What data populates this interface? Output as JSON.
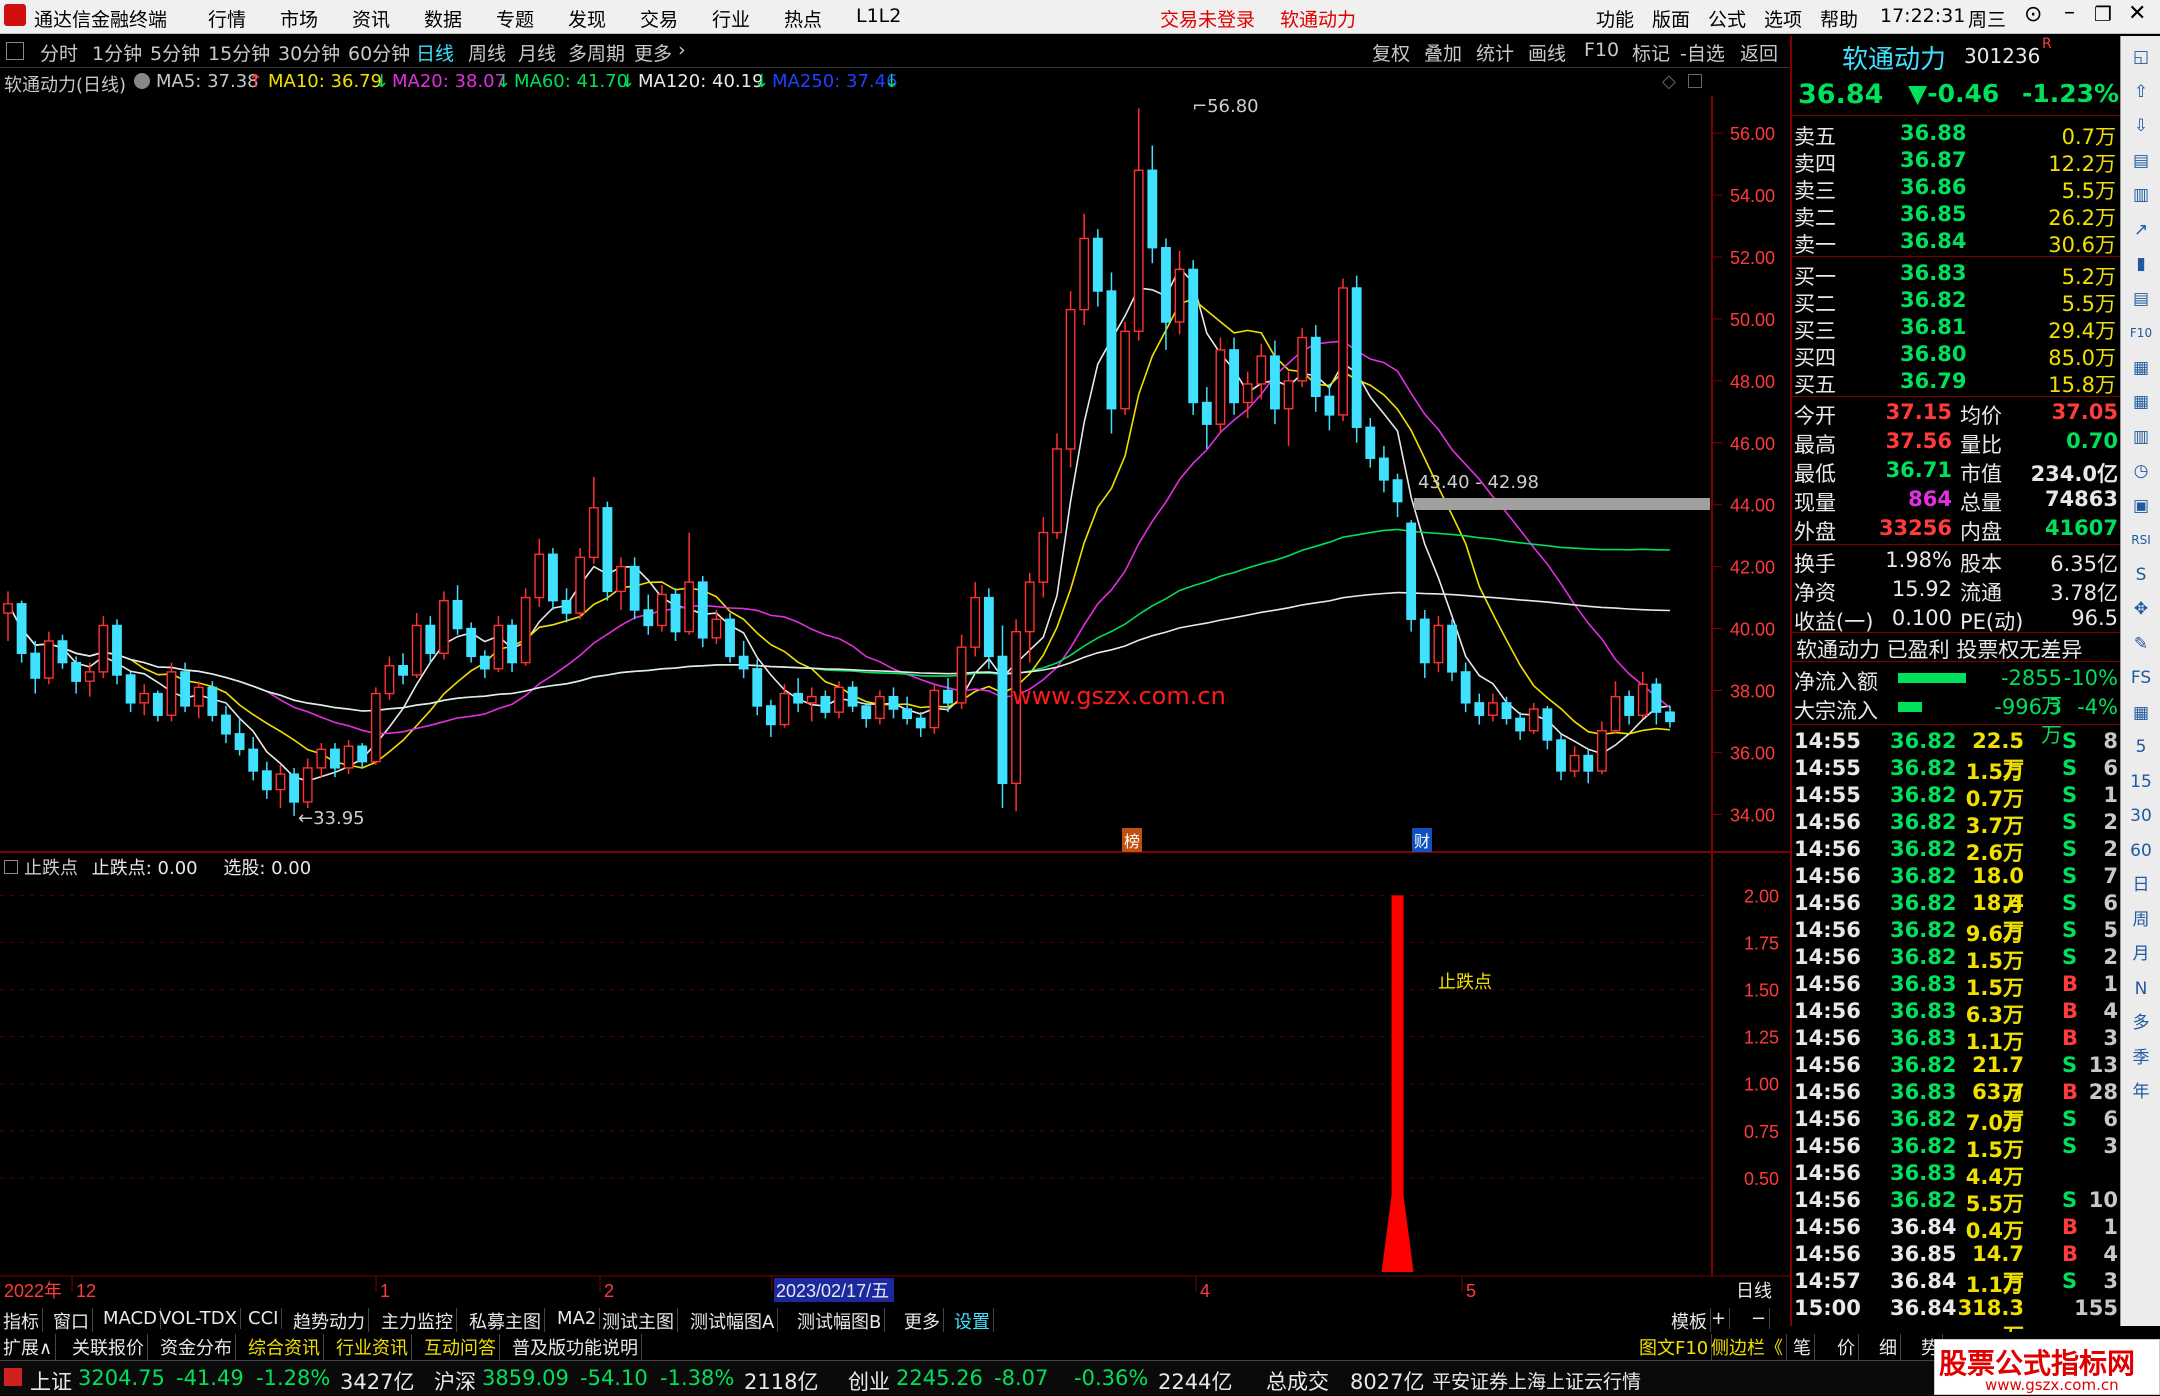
{
  "titlebar": {
    "app_name": "通达信金融终端",
    "menus": [
      "行情",
      "市场",
      "资讯",
      "数据",
      "专题",
      "发现",
      "交易",
      "行业",
      "热点",
      "L1L2"
    ],
    "login_status": "交易未登录",
    "stock_name": "软通动力",
    "right_menus": [
      "功能",
      "版面",
      "公式",
      "选项",
      "帮助"
    ],
    "time": "17:22:31",
    "weekday": "周三"
  },
  "timeframes": [
    "分时",
    "1分钟",
    "5分钟",
    "15分钟",
    "30分钟",
    "60分钟",
    "日线",
    "周线",
    "月线",
    "多周期",
    "更多"
  ],
  "active_timeframe": "日线",
  "toolbar_buttons": [
    "复权",
    "叠加",
    "统计",
    "画线",
    "F10",
    "标记",
    "-自选",
    "返回"
  ],
  "ma_bar": {
    "title": "软通动力(日线)",
    "items": [
      {
        "label": "MA5: 37.38",
        "color": "#e8e8e8",
        "arrow": "↑"
      },
      {
        "label": "MA10: 36.79",
        "color": "#f0e000",
        "arrow": "↓"
      },
      {
        "label": "MA20: 38.07",
        "color": "#e030e0",
        "arrow": "↓"
      },
      {
        "label": "MA60: 41.70",
        "color": "#00e05a",
        "arrow": "↓"
      },
      {
        "label": "MA120: 40.19",
        "color": "#e8e8e8",
        "arrow": "↓"
      },
      {
        "label": "MA250: 37.46",
        "color": "#2040ff",
        "arrow": "↓"
      }
    ]
  },
  "chart_data": [
    {
      "type": "candlestick",
      "title": "软通动力(日线)",
      "y_ticks": [
        "56.00",
        "54.00",
        "52.00",
        "50.00",
        "48.00",
        "46.00",
        "44.00",
        "42.00",
        "40.00",
        "38.00",
        "36.00",
        "34.00"
      ],
      "ylim": [
        33.3,
        57.2
      ],
      "annotations": {
        "high": "56.80",
        "low": "33.95",
        "gap": "43.40 - 42.98",
        "markers": [
          "榜",
          "财"
        ],
        "watermark": "www.gszx.com.cn"
      },
      "candles": [
        [
          40.5,
          41.2,
          39.6,
          40.8
        ],
        [
          40.8,
          40.9,
          38.9,
          39.2
        ],
        [
          39.2,
          39.6,
          37.9,
          38.4
        ],
        [
          38.4,
          39.9,
          38.2,
          39.6
        ],
        [
          39.6,
          39.8,
          38.7,
          38.9
        ],
        [
          38.9,
          39.1,
          37.9,
          38.3
        ],
        [
          38.3,
          38.9,
          37.8,
          38.6
        ],
        [
          38.6,
          40.4,
          38.4,
          40.1
        ],
        [
          40.1,
          40.3,
          38.2,
          38.5
        ],
        [
          38.5,
          38.6,
          37.3,
          37.6
        ],
        [
          37.6,
          38.2,
          37.2,
          37.9
        ],
        [
          37.9,
          38.0,
          37.0,
          37.2
        ],
        [
          37.2,
          38.9,
          37.0,
          38.6
        ],
        [
          38.6,
          38.9,
          37.3,
          37.5
        ],
        [
          37.5,
          38.3,
          37.1,
          38.1
        ],
        [
          38.1,
          38.3,
          37.0,
          37.2
        ],
        [
          37.2,
          37.5,
          36.3,
          36.6
        ],
        [
          36.6,
          37.1,
          35.9,
          36.1
        ],
        [
          36.1,
          36.5,
          35.1,
          35.4
        ],
        [
          35.4,
          35.7,
          34.5,
          34.8
        ],
        [
          34.8,
          35.6,
          34.2,
          35.3
        ],
        [
          35.3,
          35.5,
          33.95,
          34.4
        ],
        [
          34.4,
          35.8,
          34.2,
          35.5
        ],
        [
          35.5,
          36.3,
          35.2,
          36.1
        ],
        [
          36.1,
          36.3,
          35.2,
          35.5
        ],
        [
          35.5,
          36.4,
          35.3,
          36.2
        ],
        [
          36.2,
          36.3,
          35.5,
          35.7
        ],
        [
          35.7,
          38.1,
          35.6,
          37.9
        ],
        [
          37.9,
          39.1,
          37.7,
          38.8
        ],
        [
          38.8,
          39.2,
          38.2,
          38.5
        ],
        [
          38.5,
          40.5,
          38.4,
          40.1
        ],
        [
          40.1,
          40.4,
          38.9,
          39.2
        ],
        [
          39.2,
          41.2,
          39.0,
          40.9
        ],
        [
          40.9,
          41.4,
          39.8,
          40.0
        ],
        [
          40.0,
          40.2,
          38.9,
          39.1
        ],
        [
          39.1,
          39.3,
          38.4,
          38.7
        ],
        [
          38.7,
          40.4,
          38.6,
          40.1
        ],
        [
          40.1,
          40.3,
          38.6,
          38.9
        ],
        [
          38.9,
          41.3,
          38.8,
          41.0
        ],
        [
          41.0,
          42.9,
          40.7,
          42.4
        ],
        [
          42.4,
          42.6,
          40.6,
          40.9
        ],
        [
          40.9,
          41.3,
          40.2,
          40.5
        ],
        [
          40.5,
          42.6,
          40.3,
          42.3
        ],
        [
          42.3,
          44.9,
          42.1,
          43.9
        ],
        [
          43.9,
          44.1,
          40.9,
          41.2
        ],
        [
          41.2,
          42.3,
          40.6,
          42.0
        ],
        [
          42.0,
          42.3,
          40.3,
          40.6
        ],
        [
          40.6,
          41.1,
          39.8,
          40.1
        ],
        [
          40.1,
          41.4,
          39.9,
          41.1
        ],
        [
          41.1,
          41.3,
          39.6,
          39.9
        ],
        [
          39.9,
          43.1,
          39.8,
          41.5
        ],
        [
          41.5,
          41.7,
          39.4,
          39.7
        ],
        [
          39.7,
          40.6,
          39.5,
          40.3
        ],
        [
          40.3,
          40.5,
          38.9,
          39.1
        ],
        [
          39.1,
          39.6,
          38.4,
          38.7
        ],
        [
          38.7,
          39.0,
          37.2,
          37.5
        ],
        [
          37.5,
          37.7,
          36.5,
          36.9
        ],
        [
          36.9,
          38.2,
          36.8,
          37.9
        ],
        [
          37.9,
          38.4,
          37.3,
          37.6
        ],
        [
          37.6,
          38.1,
          37.0,
          37.8
        ],
        [
          37.8,
          38.0,
          37.1,
          37.3
        ],
        [
          37.3,
          38.3,
          37.1,
          38.1
        ],
        [
          38.1,
          38.3,
          37.3,
          37.5
        ],
        [
          37.5,
          37.6,
          36.8,
          37.1
        ],
        [
          37.1,
          38.0,
          36.9,
          37.8
        ],
        [
          37.8,
          38.1,
          37.1,
          37.4
        ],
        [
          37.4,
          37.8,
          36.9,
          37.1
        ],
        [
          37.1,
          37.3,
          36.5,
          36.8
        ],
        [
          36.8,
          38.2,
          36.6,
          38.0
        ],
        [
          38.0,
          38.4,
          37.3,
          37.6
        ],
        [
          37.6,
          39.8,
          37.4,
          39.4
        ],
        [
          39.4,
          41.5,
          39.1,
          41.0
        ],
        [
          41.0,
          41.3,
          38.7,
          39.1
        ],
        [
          39.1,
          40.1,
          34.2,
          35.0
        ],
        [
          35.0,
          40.3,
          34.1,
          39.9
        ],
        [
          39.9,
          41.8,
          38.9,
          41.5
        ],
        [
          41.5,
          43.6,
          41.0,
          43.1
        ],
        [
          43.1,
          46.3,
          42.9,
          45.8
        ],
        [
          45.8,
          50.9,
          45.2,
          50.3
        ],
        [
          50.3,
          53.4,
          49.8,
          52.6
        ],
        [
          52.6,
          52.9,
          50.4,
          50.9
        ],
        [
          50.9,
          51.5,
          46.3,
          47.1
        ],
        [
          47.1,
          49.9,
          46.9,
          49.6
        ],
        [
          49.6,
          56.8,
          49.3,
          54.8
        ],
        [
          54.8,
          55.6,
          51.8,
          52.3
        ],
        [
          52.3,
          52.6,
          49.0,
          49.9
        ],
        [
          49.9,
          52.2,
          49.5,
          51.6
        ],
        [
          51.6,
          51.9,
          46.9,
          47.3
        ],
        [
          47.3,
          47.8,
          45.8,
          46.6
        ],
        [
          46.6,
          49.4,
          46.3,
          49.0
        ],
        [
          49.0,
          49.4,
          46.9,
          47.3
        ],
        [
          47.3,
          48.3,
          46.8,
          47.9
        ],
        [
          47.9,
          49.2,
          47.4,
          48.8
        ],
        [
          48.8,
          49.3,
          46.6,
          47.1
        ],
        [
          47.1,
          48.3,
          45.9,
          48.0
        ],
        [
          48.0,
          49.7,
          47.8,
          49.4
        ],
        [
          49.4,
          49.8,
          47.0,
          47.5
        ],
        [
          47.5,
          47.9,
          46.4,
          46.9
        ],
        [
          46.9,
          51.3,
          46.7,
          51.0
        ],
        [
          51.0,
          51.4,
          46.0,
          46.5
        ],
        [
          46.5,
          46.8,
          45.2,
          45.5
        ],
        [
          45.5,
          45.9,
          44.4,
          44.8
        ],
        [
          44.8,
          45.0,
          43.6,
          44.1
        ],
        [
          43.4,
          43.5,
          39.9,
          40.3
        ],
        [
          40.3,
          40.6,
          38.4,
          38.9
        ],
        [
          38.9,
          40.4,
          38.6,
          40.1
        ],
        [
          40.1,
          40.3,
          38.3,
          38.6
        ],
        [
          38.6,
          38.9,
          37.3,
          37.6
        ],
        [
          37.6,
          37.9,
          36.9,
          37.2
        ],
        [
          37.2,
          37.9,
          37.0,
          37.6
        ],
        [
          37.6,
          37.8,
          36.9,
          37.1
        ],
        [
          37.1,
          37.3,
          36.4,
          36.7
        ],
        [
          36.7,
          37.6,
          36.6,
          37.4
        ],
        [
          37.4,
          37.5,
          36.1,
          36.4
        ],
        [
          36.4,
          36.6,
          35.1,
          35.4
        ],
        [
          35.4,
          36.2,
          35.2,
          35.9
        ],
        [
          35.9,
          36.1,
          35.0,
          35.4
        ],
        [
          35.4,
          37.0,
          35.3,
          36.7
        ],
        [
          36.7,
          38.3,
          36.6,
          37.8
        ],
        [
          37.8,
          38.0,
          36.9,
          37.2
        ],
        [
          37.2,
          38.6,
          37.1,
          38.2
        ],
        [
          38.2,
          38.4,
          36.9,
          37.3
        ],
        [
          37.3,
          37.5,
          36.8,
          37.0
        ]
      ]
    },
    {
      "type": "bar",
      "title": "止跌点",
      "values_text": "止跌点: 0.00",
      "select_text": "选股: 0.00",
      "y_ticks": [
        "2.00",
        "1.75",
        "1.50",
        "1.25",
        "1.00",
        "0.75",
        "0.50"
      ],
      "ylim": [
        0,
        2.05
      ],
      "spike_label": "止跌点",
      "spike_value": 2.0
    }
  ],
  "x_axis": [
    "2022年",
    "12",
    "1",
    "2",
    "2023/02/17/五",
    "4",
    "5",
    "日线"
  ],
  "quote": {
    "name": "软通动力",
    "code": "301236",
    "badge": "R",
    "price": "36.84",
    "change": "▼-0.46",
    "pct": "-1.23%",
    "asks": [
      {
        "label": "卖五",
        "price": "36.88",
        "vol": "0.7万"
      },
      {
        "label": "卖四",
        "price": "36.87",
        "vol": "12.2万"
      },
      {
        "label": "卖三",
        "price": "36.86",
        "vol": "5.5万"
      },
      {
        "label": "卖二",
        "price": "36.85",
        "vol": "26.2万"
      },
      {
        "label": "卖一",
        "price": "36.84",
        "vol": "30.6万"
      }
    ],
    "bids": [
      {
        "label": "买一",
        "price": "36.83",
        "vol": "5.2万"
      },
      {
        "label": "买二",
        "price": "36.82",
        "vol": "5.5万"
      },
      {
        "label": "买三",
        "price": "36.81",
        "vol": "29.4万"
      },
      {
        "label": "买四",
        "price": "36.80",
        "vol": "85.0万"
      },
      {
        "label": "买五",
        "price": "36.79",
        "vol": "15.8万"
      }
    ],
    "stats1": [
      {
        "l1": "今开",
        "v1": "37.15",
        "c1": "#ff3b3b",
        "l2": "均价",
        "v2": "37.05",
        "c2": "#ff3b3b"
      },
      {
        "l1": "最高",
        "v1": "37.56",
        "c1": "#ff3b3b",
        "l2": "量比",
        "v2": "0.70",
        "c2": "#00e05a"
      },
      {
        "l1": "最低",
        "v1": "36.71",
        "c1": "#00e05a",
        "l2": "市值",
        "v2": "234.0亿",
        "c2": "#e8e8e8"
      },
      {
        "l1": "现量",
        "v1": "864",
        "c1": "#e030e0",
        "l2": "总量",
        "v2": "74863",
        "c2": "#e8e8e8"
      },
      {
        "l1": "外盘",
        "v1": "33256",
        "c1": "#ff3b3b",
        "l2": "内盘",
        "v2": "41607",
        "c2": "#00e05a"
      }
    ],
    "stats2": [
      {
        "l1": "换手",
        "v1": "1.98%",
        "l2": "股本",
        "v2": "6.35亿"
      },
      {
        "l1": "净资",
        "v1": "15.92",
        "l2": "流通",
        "v2": "3.78亿"
      },
      {
        "l1": "收益(一)",
        "v1": "0.100",
        "l2": "PE(动)",
        "v2": "96.5"
      }
    ],
    "tags": "软通动力 已盈利 投票权无差异",
    "flows": [
      {
        "label": "净流入额",
        "value": "-2855万",
        "pct": "-10%",
        "bar": 0.62
      },
      {
        "label": "大宗流入",
        "value": "-996.3万",
        "pct": "-4%",
        "bar": 0.22
      }
    ]
  },
  "ticks": [
    [
      "14:55",
      "36.82",
      "22.5万",
      "S",
      "8"
    ],
    [
      "14:55",
      "36.82",
      "1.5万",
      "S",
      "6"
    ],
    [
      "14:55",
      "36.82",
      "0.7万",
      "S",
      "1"
    ],
    [
      "14:56",
      "36.82",
      "3.7万",
      "S",
      "2"
    ],
    [
      "14:56",
      "36.82",
      "2.6万",
      "S",
      "2"
    ],
    [
      "14:56",
      "36.82",
      "18.0万",
      "S",
      "7"
    ],
    [
      "14:56",
      "36.82",
      "18.4万",
      "S",
      "6"
    ],
    [
      "14:56",
      "36.82",
      "9.6万",
      "S",
      "5"
    ],
    [
      "14:56",
      "36.82",
      "1.5万",
      "S",
      "2"
    ],
    [
      "14:56",
      "36.83",
      "1.5万",
      "B",
      "1"
    ],
    [
      "14:56",
      "36.83",
      "6.3万",
      "B",
      "4"
    ],
    [
      "14:56",
      "36.83",
      "1.1万",
      "B",
      "3"
    ],
    [
      "14:56",
      "36.82",
      "21.7万",
      "S",
      "13"
    ],
    [
      "14:56",
      "36.83",
      "63.7万",
      "B",
      "28"
    ],
    [
      "14:56",
      "36.82",
      "7.0万",
      "S",
      "6"
    ],
    [
      "14:56",
      "36.82",
      "1.5万",
      "S",
      "3"
    ],
    [
      "14:56",
      "36.83",
      "4.4万",
      "",
      ""
    ],
    [
      "14:56",
      "36.82",
      "5.5万",
      "S",
      "10"
    ],
    [
      "14:56",
      "36.84",
      "0.4万",
      "B",
      "1"
    ],
    [
      "14:56",
      "36.85",
      "14.7万",
      "B",
      "4"
    ],
    [
      "14:57",
      "36.84",
      "1.1万",
      "S",
      "3"
    ],
    [
      "15:00",
      "36.84",
      "318.3万",
      "",
      "155"
    ]
  ],
  "bottom_tabs": [
    "指标",
    "窗口",
    "MACD",
    "VOL-TDX",
    "CCI",
    "趋势动力",
    "主力监控",
    "私募主图",
    "MA2",
    "测试主图",
    "测试幅图A",
    "测试幅图B",
    "更多",
    "设置"
  ],
  "bottom_right_tabs": [
    "模板",
    "+",
    "−"
  ],
  "bottom_tabs2": [
    "扩展∧",
    "关联报价",
    "资金分布",
    "综合资讯",
    "行业资讯",
    "互动问答",
    "普及版功能说明"
  ],
  "bottom_tabs2_right": [
    "图文F10",
    "侧边栏《",
    "笔",
    "价",
    "细",
    "势"
  ],
  "status": [
    {
      "label": "上证",
      "value": "3204.75",
      "chg": "-41.49",
      "pct": "-1.28%",
      "amt": "3427亿"
    },
    {
      "label": "沪深",
      "value": "3859.09",
      "chg": "-54.10",
      "pct": "-1.38%",
      "amt": "2118亿"
    },
    {
      "label": "创业",
      "value": "2245.26",
      "chg": "-8.07",
      "pct": "-0.36%",
      "amt": "2244亿"
    }
  ],
  "status_total_label": "总成交",
  "status_total": "8027亿",
  "status_broker": "平安证券上海上证云行情",
  "logo_text": "股票公式指标网",
  "logo_url": "www.gszx.com.cn",
  "sidebar_icons": [
    "◱",
    "⇧",
    "⇩",
    "▤",
    "▥",
    "↗",
    "▮",
    "▤",
    "F10",
    "▦",
    "▦",
    "▥",
    "◷",
    "▣",
    "RSI",
    "S",
    "✥",
    "✎",
    "FS",
    "▦",
    "5",
    "15",
    "30",
    "60",
    "日",
    "周",
    "月",
    "N",
    "多",
    "季",
    "年"
  ]
}
